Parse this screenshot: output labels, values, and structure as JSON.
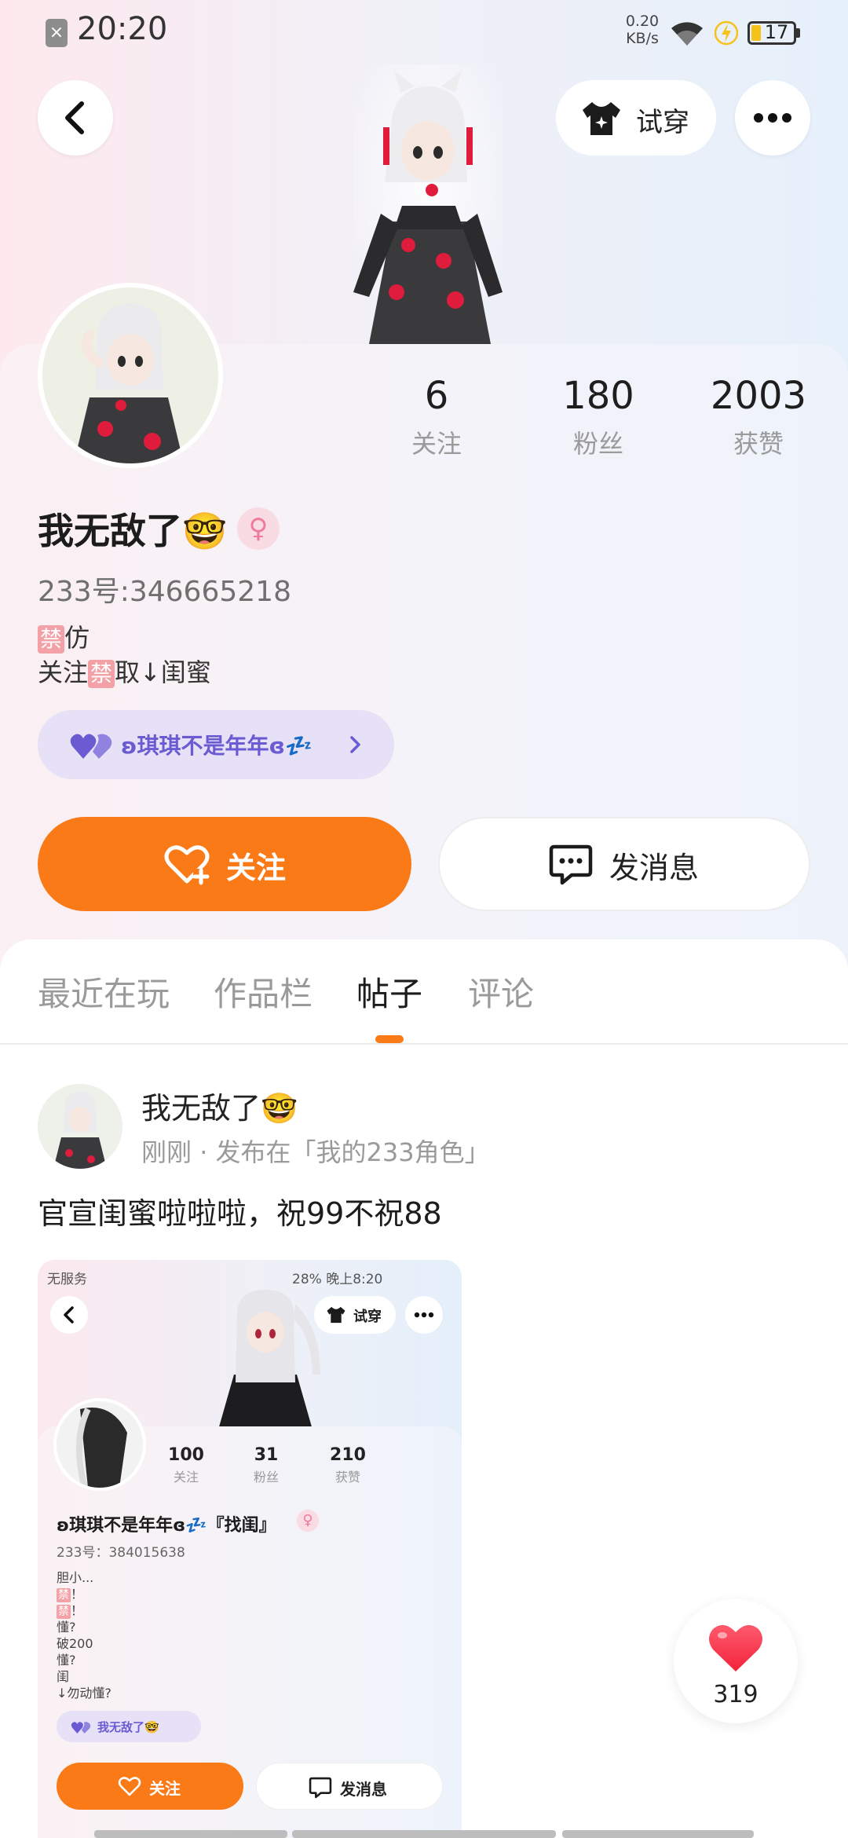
{
  "status_bar": {
    "time": "20:20",
    "net_speed": "0.20",
    "net_unit": "KB/s",
    "battery": "17"
  },
  "header": {
    "try_on_label": "试穿"
  },
  "profile": {
    "stats": [
      {
        "value": "6",
        "label": "关注"
      },
      {
        "value": "180",
        "label": "粉丝"
      },
      {
        "value": "2003",
        "label": "获赞"
      }
    ],
    "username": "我无敌了🤓",
    "gender_symbol": "♀",
    "id_text": "233号:346665218",
    "bio_line1_ban": "禁",
    "bio_line1_rest": "仿",
    "bio_line2_pre": "关注",
    "bio_line2_ban": "禁",
    "bio_line2_post": "取↓闺蜜",
    "bestie_name": "ʚ琪琪不是年年ɞ💤",
    "follow_label": "关注",
    "message_label": "发消息"
  },
  "tabs": [
    {
      "label": "最近在玩",
      "active": false
    },
    {
      "label": "作品栏",
      "active": false
    },
    {
      "label": "帖子",
      "active": true
    },
    {
      "label": "评论",
      "active": false
    }
  ],
  "post": {
    "author": "我无敌了🤓",
    "time": "刚刚",
    "published_in": "发布在「我的233角色」",
    "text": "官宣闺蜜啦啦啦，祝99不祝88",
    "like_count": "319"
  },
  "inner_shot": {
    "status_left": "无服务",
    "status_right": "28%  晚上8:20",
    "try_on": "试穿",
    "stats": [
      {
        "value": "100",
        "label": "关注"
      },
      {
        "value": "31",
        "label": "粉丝"
      },
      {
        "value": "210",
        "label": "获赞"
      }
    ],
    "name": "ʚ琪琪不是年年ɞ💤『找闺』",
    "gender_symbol": "♀",
    "id_text": "233号：384015638",
    "bio_l1": "胆小...",
    "bio_ban": "禁",
    "bio_excl": "！",
    "bio_l4": "懂?",
    "bio_l5": "破200",
    "bio_l6": "懂?",
    "bio_l7": "闺",
    "bio_l8": "↓勿动懂?",
    "bestie": "我无敌了🤓",
    "follow": "关注",
    "message": "发消息"
  }
}
